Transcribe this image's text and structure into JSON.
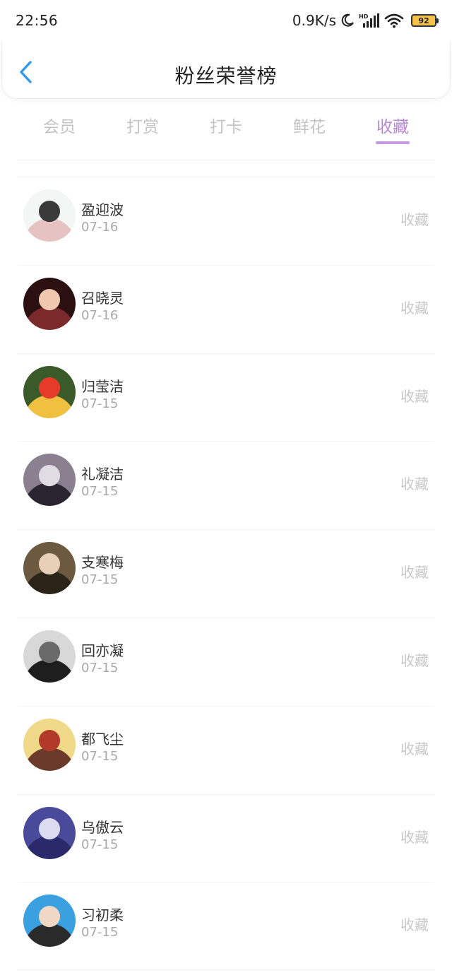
{
  "status_bar": {
    "time": "22:56",
    "network_speed": "0.9K/s",
    "battery_level": "92",
    "icons": [
      "moon-icon",
      "hd-signal-icon",
      "wifi-icon",
      "battery-icon"
    ]
  },
  "header": {
    "title": "粉丝荣誉榜",
    "back_icon": "chevron-left-icon",
    "accent_color": "#2f9bea"
  },
  "tabs": [
    {
      "label": "会员",
      "active": false
    },
    {
      "label": "打赏",
      "active": false
    },
    {
      "label": "打卡",
      "active": false
    },
    {
      "label": "鲜花",
      "active": false
    },
    {
      "label": "收藏",
      "active": true
    }
  ],
  "active_tab_color": "#b688d6",
  "fans": [
    {
      "name": "盈迎波",
      "date": "07-16",
      "action": "收藏",
      "avatar_palette": [
        "#f2f6f4",
        "#3a3a3a",
        "#e7c2c2"
      ]
    },
    {
      "name": "召晓灵",
      "date": "07-16",
      "action": "收藏",
      "avatar_palette": [
        "#2a1010",
        "#f0c8b0",
        "#7a2a2a"
      ]
    },
    {
      "name": "归莹洁",
      "date": "07-15",
      "action": "收藏",
      "avatar_palette": [
        "#3b5a2a",
        "#e63a2a",
        "#f0c040"
      ]
    },
    {
      "name": "礼凝洁",
      "date": "07-15",
      "action": "收藏",
      "avatar_palette": [
        "#8a8090",
        "#e0dce4",
        "#2a2430"
      ]
    },
    {
      "name": "支寒梅",
      "date": "07-15",
      "action": "收藏",
      "avatar_palette": [
        "#6b5a40",
        "#e8d0b8",
        "#2a2418"
      ]
    },
    {
      "name": "回亦凝",
      "date": "07-15",
      "action": "收藏",
      "avatar_palette": [
        "#d8d8d8",
        "#6a6a6a",
        "#1e1e1e"
      ]
    },
    {
      "name": "都飞尘",
      "date": "07-15",
      "action": "收藏",
      "avatar_palette": [
        "#f1d98a",
        "#b23a2a",
        "#6a3a2a"
      ]
    },
    {
      "name": "乌傲云",
      "date": "07-15",
      "action": "收藏",
      "avatar_palette": [
        "#4a4a9a",
        "#dcdcf0",
        "#2a2a6a"
      ]
    },
    {
      "name": "习初柔",
      "date": "07-15",
      "action": "收藏",
      "avatar_palette": [
        "#3aa0e0",
        "#f0d8c4",
        "#2a2a2a"
      ]
    }
  ]
}
